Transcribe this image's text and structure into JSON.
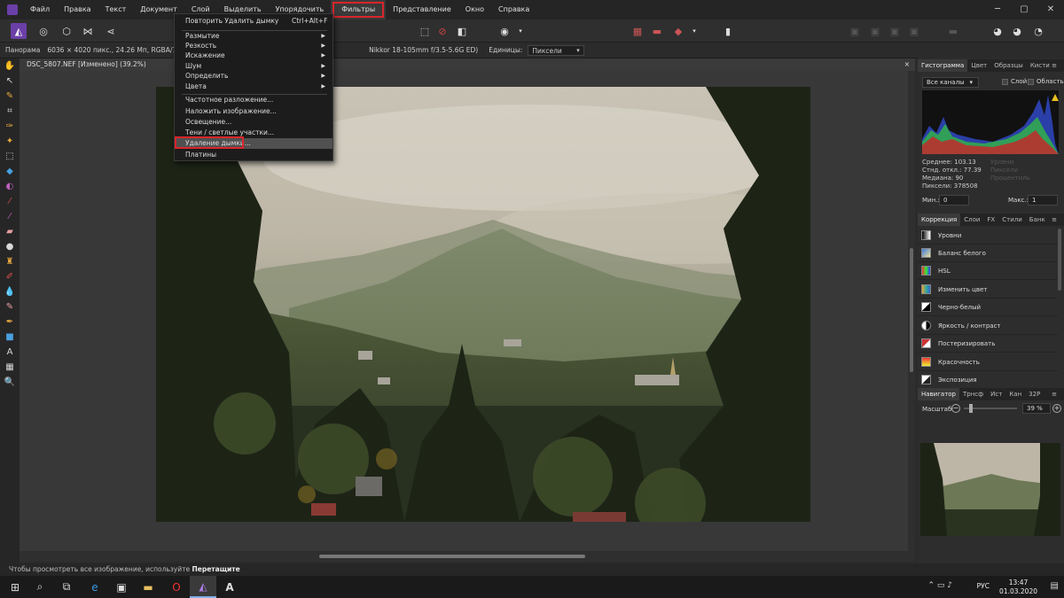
{
  "menubar": {
    "items": [
      "Файл",
      "Правка",
      "Текст",
      "Документ",
      "Слой",
      "Выделить",
      "Упорядочить",
      "Фильтры",
      "Представление",
      "Окно",
      "Справка"
    ],
    "active": "Фильтры"
  },
  "filters_menu": {
    "repeat": "Повторить Удалить дымку",
    "repeat_shortcut": "Ctrl+Alt+F",
    "groups": [
      "Размытие",
      "Резкость",
      "Искажение",
      "Шум",
      "Определить",
      "Цвета"
    ],
    "items": [
      "Частотное разложение...",
      "Наложить изображение...",
      "Освещение...",
      "Тени / светлые участки...",
      "Удаление дымки...",
      "Платины"
    ],
    "highlighted": "Удаление дымки..."
  },
  "contextbar": {
    "mode": "Панорама",
    "info": "6036 × 4020 пикс., 24.26 Мп, RGBA/16 — s",
    "lens": "Nikkor 18-105mm f/3.5-5.6G ED)",
    "units_label": "Единицы:",
    "units_value": "Пиксели"
  },
  "document": {
    "tab_title": "DSC_5807.NEF [Изменено] (39.2%)",
    "close": "×"
  },
  "status": {
    "text": "Чтобы просмотреть все изображение, используйте",
    "bold": "Перетащите"
  },
  "histogram_panel": {
    "tabs": [
      "Гистограмма",
      "Цвет",
      "Образцы",
      "Кисти"
    ],
    "channel": "Все каналы",
    "layer_label": "Слой",
    "area_label": "Область",
    "stats": [
      "Среднее: 103.13",
      "Стнд. откл.: 77.39",
      "Медиана: 90",
      "Пиксели: 378508"
    ],
    "stats_dim": [
      "Уровни",
      "Пиксели",
      "Процентиль"
    ],
    "min_label": "Мин.:",
    "min_value": "0",
    "max_label": "Макс.:",
    "max_value": "1"
  },
  "adjustment_panel": {
    "tabs": [
      "Коррекция",
      "Слои",
      "FX",
      "Стили",
      "Банк"
    ],
    "items": [
      "Уровни",
      "Баланс белого",
      "HSL",
      "Изменить цвет",
      "Черно-белый",
      "Яркость / контраст",
      "Постеризировать",
      "Красочность",
      "Экспозиция"
    ]
  },
  "navigator_panel": {
    "tabs": [
      "Навигатор",
      "Трнсф",
      "Ист",
      "Кан",
      "32P"
    ],
    "zoom_label": "Масштаб:",
    "zoom_value": "39 %"
  },
  "taskbar": {
    "lang": "РУС",
    "time": "13:47",
    "date": "01.03.2020"
  },
  "colors": {
    "accent_red": "#d9252b",
    "panel_bg": "#2d2d2d",
    "affinity_purple": "#6b3fa8"
  }
}
